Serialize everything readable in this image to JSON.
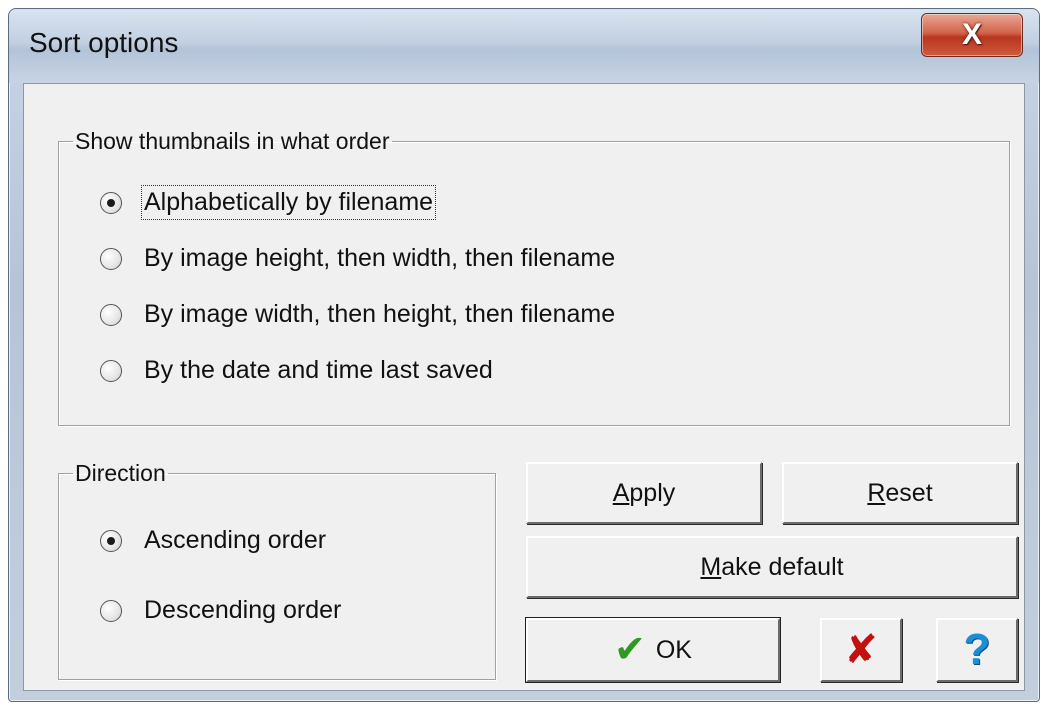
{
  "window": {
    "title": "Sort options",
    "close_glyph": "X"
  },
  "order_group": {
    "legend": "Show thumbnails in what order",
    "options": [
      {
        "label": "Alphabetically by filename",
        "checked": true
      },
      {
        "label": "By image height, then width, then filename",
        "checked": false
      },
      {
        "label": "By image width, then height, then filename",
        "checked": false
      },
      {
        "label": "By the date and time last saved",
        "checked": false
      }
    ]
  },
  "direction_group": {
    "legend": "Direction",
    "options": [
      {
        "label": "Ascending order",
        "checked": true
      },
      {
        "label": "Descending order",
        "checked": false
      }
    ]
  },
  "buttons": {
    "apply": {
      "accel": "A",
      "rest": "pply"
    },
    "reset": {
      "accel": "R",
      "rest": "eset"
    },
    "make_default": {
      "accel": "M",
      "rest": "ake default"
    },
    "ok": {
      "label": "OK",
      "icon": "green-check-icon",
      "glyph": "✔"
    },
    "cancel": {
      "icon": "red-x-icon",
      "glyph": "✘"
    },
    "help": {
      "icon": "help-question-icon",
      "glyph": "?"
    }
  },
  "colors": {
    "ok_check": "#2e9a22",
    "cancel_x": "#c41010",
    "help_q": "#1a8fd8",
    "close_button": "#c94a30"
  }
}
